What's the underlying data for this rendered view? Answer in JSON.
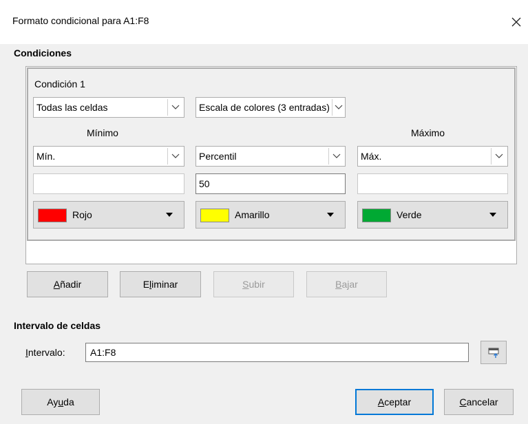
{
  "window": {
    "title": "Formato condicional para A1:F8",
    "close_icon": "close-icon"
  },
  "conditions": {
    "section_label": "Condiciones",
    "condition_label": "Condición 1",
    "applies_to": "Todas las celdas",
    "format_type": "Escala de colores (3 entradas)",
    "min_label": "Mínimo",
    "max_label": "Máximo",
    "min": {
      "type": "Mín.",
      "value": "",
      "color_name": "Rojo",
      "color": "#ff0000"
    },
    "mid": {
      "type": "Percentil",
      "value": "50",
      "color_name": "Amarillo",
      "color": "#ffff00"
    },
    "max": {
      "type": "Máx.",
      "value": "",
      "color_name": "Verde",
      "color": "#00a933"
    }
  },
  "actions": {
    "add": {
      "pre": "",
      "u": "A",
      "post": "ñadir"
    },
    "delete": {
      "pre": "E",
      "u": "l",
      "post": "iminar"
    },
    "up": {
      "pre": "",
      "u": "S",
      "post": "ubir"
    },
    "down": {
      "pre": "",
      "u": "B",
      "post": "ajar"
    }
  },
  "range": {
    "section_label": "Intervalo de celdas",
    "label": {
      "pre": "",
      "u": "I",
      "post": "ntervalo:"
    },
    "value": "A1:F8",
    "shrink_icon": "shrink-icon"
  },
  "footer": {
    "help": {
      "pre": "Ay",
      "u": "u",
      "post": "da"
    },
    "ok": {
      "pre": "",
      "u": "A",
      "post": "ceptar"
    },
    "cancel": {
      "pre": "",
      "u": "C",
      "post": "ancelar"
    }
  },
  "colors": {
    "accent": "#0078d7",
    "dialog_bg": "#f0f0f0"
  }
}
